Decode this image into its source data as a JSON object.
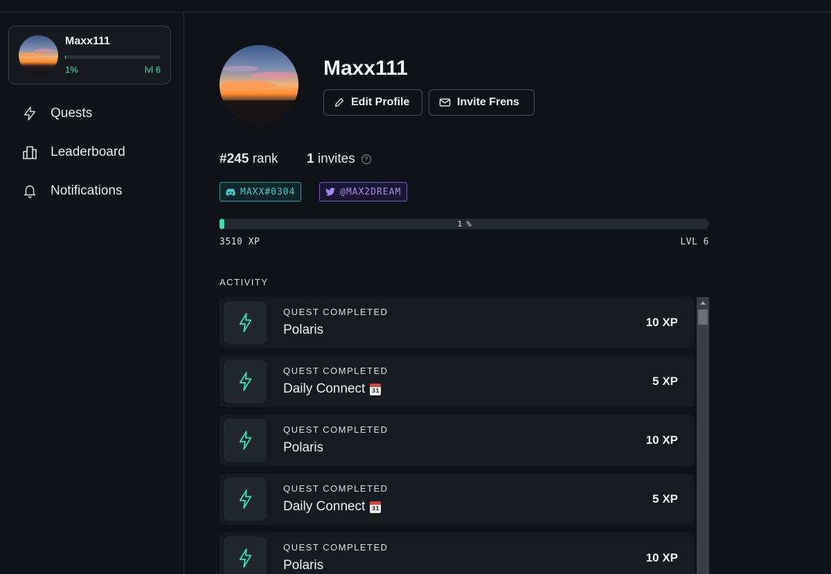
{
  "sidebar": {
    "user": {
      "name": "Maxx111",
      "progress_percent": 1,
      "progress_label": "1%",
      "level_label": "lvl 6"
    },
    "nav": [
      {
        "label": "Quests",
        "icon": "lightning-icon"
      },
      {
        "label": "Leaderboard",
        "icon": "leaderboard-icon"
      },
      {
        "label": "Notifications",
        "icon": "bell-icon"
      }
    ]
  },
  "profile": {
    "name": "Maxx111",
    "edit_label": "Edit Profile",
    "invite_label": "Invite Frens",
    "rank_value": "#245",
    "rank_label": "rank",
    "invites_value": "1",
    "invites_label": "invites",
    "help_glyph": "?",
    "discord": "MAXX#0304",
    "twitter": "@MAX2DREAM",
    "xp_percent": 1,
    "xp_percent_label": "1 %",
    "xp_label": "3510 XP",
    "level_label": "LVL 6"
  },
  "activity": {
    "title": "ACTIVITY",
    "items": [
      {
        "kind": "QUEST COMPLETED",
        "title": "Polaris",
        "calendar": false,
        "xp": "10 XP"
      },
      {
        "kind": "QUEST COMPLETED",
        "title": "Daily Connect",
        "calendar": true,
        "xp": "5 XP"
      },
      {
        "kind": "QUEST COMPLETED",
        "title": "Polaris",
        "calendar": false,
        "xp": "10 XP"
      },
      {
        "kind": "QUEST COMPLETED",
        "title": "Daily Connect",
        "calendar": true,
        "xp": "5 XP"
      },
      {
        "kind": "QUEST COMPLETED",
        "title": "Polaris",
        "calendar": false,
        "xp": "10 XP"
      }
    ],
    "calendar_day": "31"
  },
  "colors": {
    "accent": "#2ee6b5",
    "background": "#0f1216",
    "discord": "#3fcfcf",
    "twitter": "#a48af0"
  }
}
